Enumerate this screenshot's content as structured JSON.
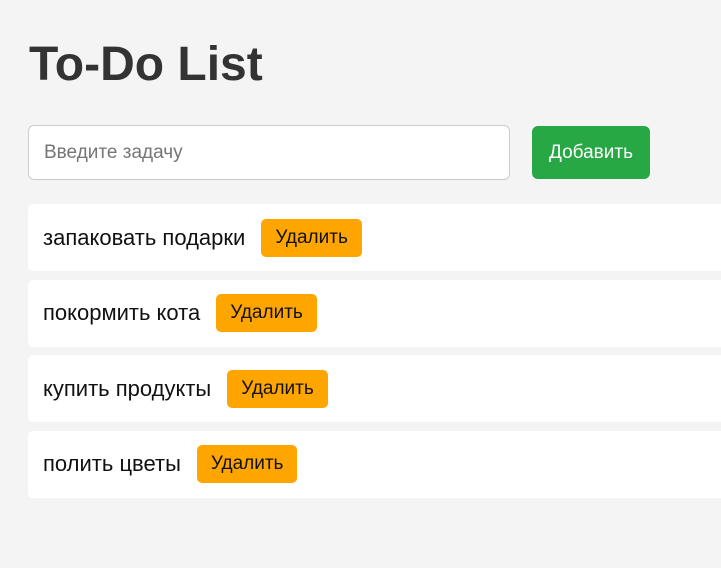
{
  "header": {
    "title": "To-Do List"
  },
  "add_form": {
    "input_placeholder": "Введите задачу",
    "input_value": "",
    "add_button_label": "Добавить"
  },
  "tasks": [
    {
      "text": "запаковать подарки",
      "delete_label": "Удалить"
    },
    {
      "text": "покормить кота",
      "delete_label": "Удалить"
    },
    {
      "text": "купить продукты",
      "delete_label": "Удалить"
    },
    {
      "text": "полить цветы",
      "delete_label": "Удалить"
    }
  ],
  "colors": {
    "background": "#f4f4f4",
    "title": "#333333",
    "add_button": "#28a745",
    "delete_button": "#ffa500",
    "task_card": "#ffffff"
  }
}
